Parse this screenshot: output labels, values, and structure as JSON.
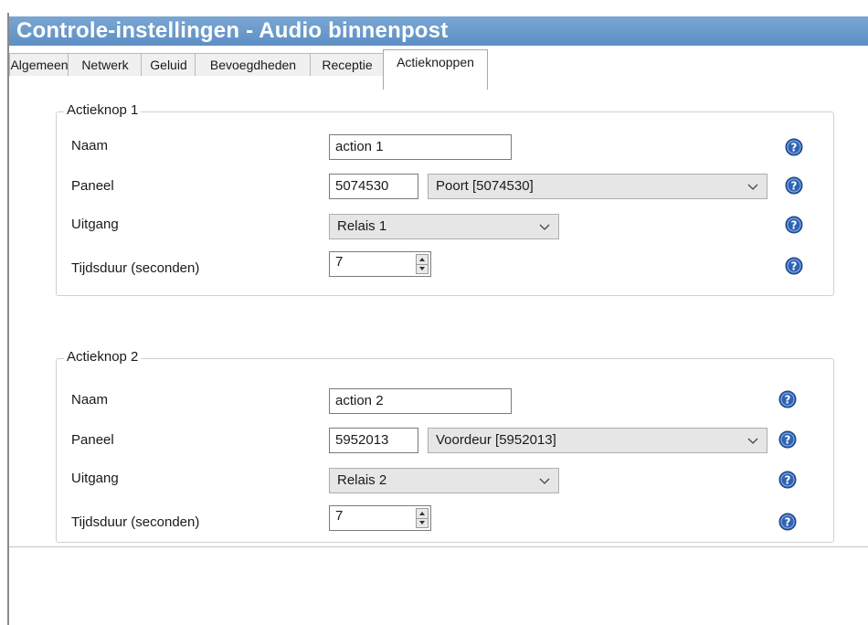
{
  "window": {
    "title": "Controle-instellingen - Audio binnenpost"
  },
  "tabs": [
    {
      "label": "Algemeen",
      "active": false
    },
    {
      "label": "Netwerk",
      "active": false
    },
    {
      "label": "Geluid",
      "active": false
    },
    {
      "label": "Bevoegdheden",
      "active": false
    },
    {
      "label": "Receptie",
      "active": false
    },
    {
      "label": "Actieknoppen",
      "active": true
    }
  ],
  "groups": [
    {
      "legend": "Actieknop 1",
      "name_label": "Naam",
      "name_value": "action 1",
      "panel_label": "Paneel",
      "panel_id": "5074530",
      "panel_select": "Poort [5074530]",
      "output_label": "Uitgang",
      "output_select": "Relais 1",
      "duration_label": "Tijdsduur (seconden)",
      "duration_value": "7"
    },
    {
      "legend": "Actieknop 2",
      "name_label": "Naam",
      "name_value": "action 2",
      "panel_label": "Paneel",
      "panel_id": "5952013",
      "panel_select": "Voordeur [5952013]",
      "output_label": "Uitgang",
      "output_select": "Relais 2",
      "duration_label": "Tijdsduur (seconden)",
      "duration_value": "7"
    }
  ],
  "icons": {
    "help": "help-icon",
    "dropdown": "chevron-down-icon",
    "spin_up": "spin-up-arrow-icon",
    "spin_down": "spin-down-arrow-icon"
  },
  "colors": {
    "titlebar": "#5d8fc4",
    "help_icon": "#2e63b5"
  }
}
